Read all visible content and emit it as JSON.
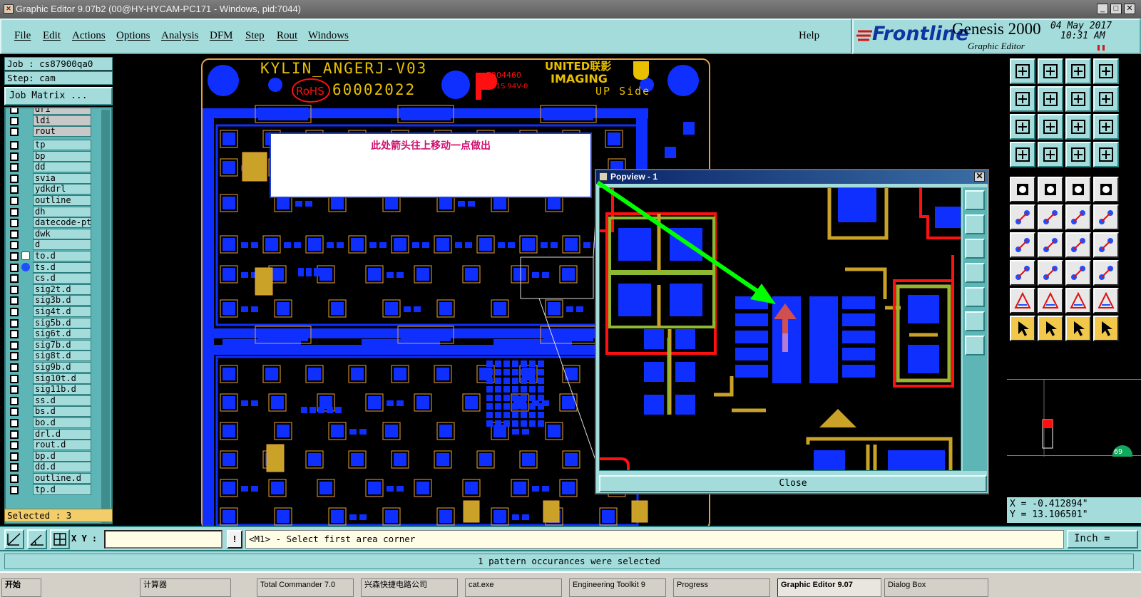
{
  "window": {
    "title": "Graphic Editor 9.07b2 (00@HY-HYCAM-PC171 - Windows, pid:7044)"
  },
  "menu": {
    "items": [
      "File",
      "Edit",
      "Actions",
      "Options",
      "Analysis",
      "DFM",
      "Step",
      "Rout",
      "Windows"
    ],
    "help": "Help"
  },
  "brand": {
    "logo": "Frontline",
    "product": "Genesis 2000",
    "subtitle": "Graphic Editor",
    "date": "04 May 2017",
    "time": "10:31 AM"
  },
  "job": {
    "job_line": "Job : cs87900qa0",
    "step_line": "Step: cam",
    "matrix_button": "Job Matrix ..."
  },
  "layers": {
    "group1": [
      "dri",
      "ldi",
      "rout"
    ],
    "group2": [
      "tp",
      "bp",
      "dd",
      "svia",
      "ydkdrl",
      "outline",
      "dh",
      "datecode-ptc",
      "dwk",
      "d",
      "to.d",
      "ts.d",
      "cs.d",
      "sig2t.d",
      "sig3b.d",
      "sig4t.d",
      "sig5b.d",
      "sig6t.d",
      "sig7b.d",
      "sig8t.d",
      "sig9b.d",
      "sig10t.d",
      "sig11b.d",
      "ss.d",
      "bs.d",
      "bo.d",
      "drl.d",
      "rout.d",
      "bp.d",
      "dd.d",
      "outline.d",
      "tp.d"
    ]
  },
  "selected_label": "Selected : 3",
  "board": {
    "name": "KYLIN_ANGERJ-V03",
    "rohs": "RoHS",
    "code": "60002022",
    "ul": "E204460",
    "ul_line2": "MI1S 94V-0",
    "united": "UNITED联影",
    "imaging": "IMAGING",
    "side": "UP Side"
  },
  "note": {
    "text": "此处箭头往上移动一点做出"
  },
  "popview": {
    "title": "Popview - 1",
    "close_label": "Close"
  },
  "coords": {
    "x_line": "X = -0.412894\"",
    "y_line": "Y = 13.106501\""
  },
  "minimap": {
    "badge": "69"
  },
  "bottom": {
    "xy_label": "X Y :",
    "xy_value": "",
    "bang": "!",
    "prompt": "<M1> - Select first area corner",
    "unit": "Inch ="
  },
  "status": {
    "message": "1 pattern occurances were selected"
  },
  "taskbar": {
    "items": [
      "开始",
      "计算器",
      "Total Commander 7.0",
      "兴森快捷电路公司",
      "cat.exe",
      "Engineering Toolkit 9",
      "Progress",
      "Graphic Editor 9.07",
      "Dialog Box"
    ]
  },
  "colors": {
    "panel": "#a4dcdc",
    "copper": "#0f2fff",
    "outline": "#e8a23a",
    "silk": "#e8c000",
    "arrow": "#00ff00",
    "accent_red": "#ff1010"
  }
}
